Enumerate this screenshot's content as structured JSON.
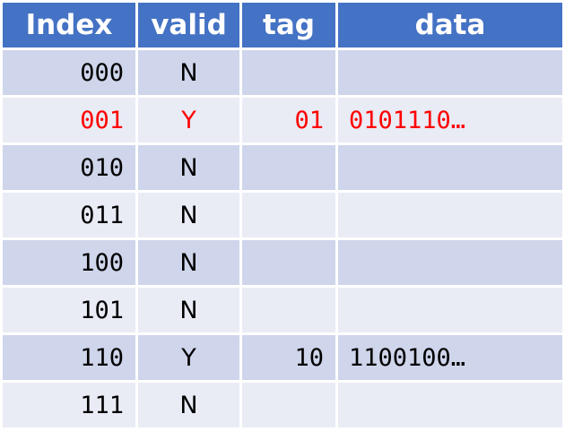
{
  "headers": {
    "index": "Index",
    "valid": "valid",
    "tag": "tag",
    "data": "data"
  },
  "rows": [
    {
      "index": "000",
      "valid": "N",
      "tag": "",
      "data": ""
    },
    {
      "index": "001",
      "valid": "Y",
      "tag": "01",
      "data": "0101110…"
    },
    {
      "index": "010",
      "valid": "N",
      "tag": "",
      "data": ""
    },
    {
      "index": "011",
      "valid": "N",
      "tag": "",
      "data": ""
    },
    {
      "index": "100",
      "valid": "N",
      "tag": "",
      "data": ""
    },
    {
      "index": "101",
      "valid": "N",
      "tag": "",
      "data": ""
    },
    {
      "index": "110",
      "valid": "Y",
      "tag": "10",
      "data": "1100100…"
    },
    {
      "index": "111",
      "valid": "N",
      "tag": "",
      "data": ""
    }
  ],
  "colors": {
    "header_background": "#4472c4",
    "row_dark": "#cfd5ea",
    "row_light": "#e9ebf5",
    "highlight_text": "#ff0000"
  },
  "highlighted_row_index": "001"
}
